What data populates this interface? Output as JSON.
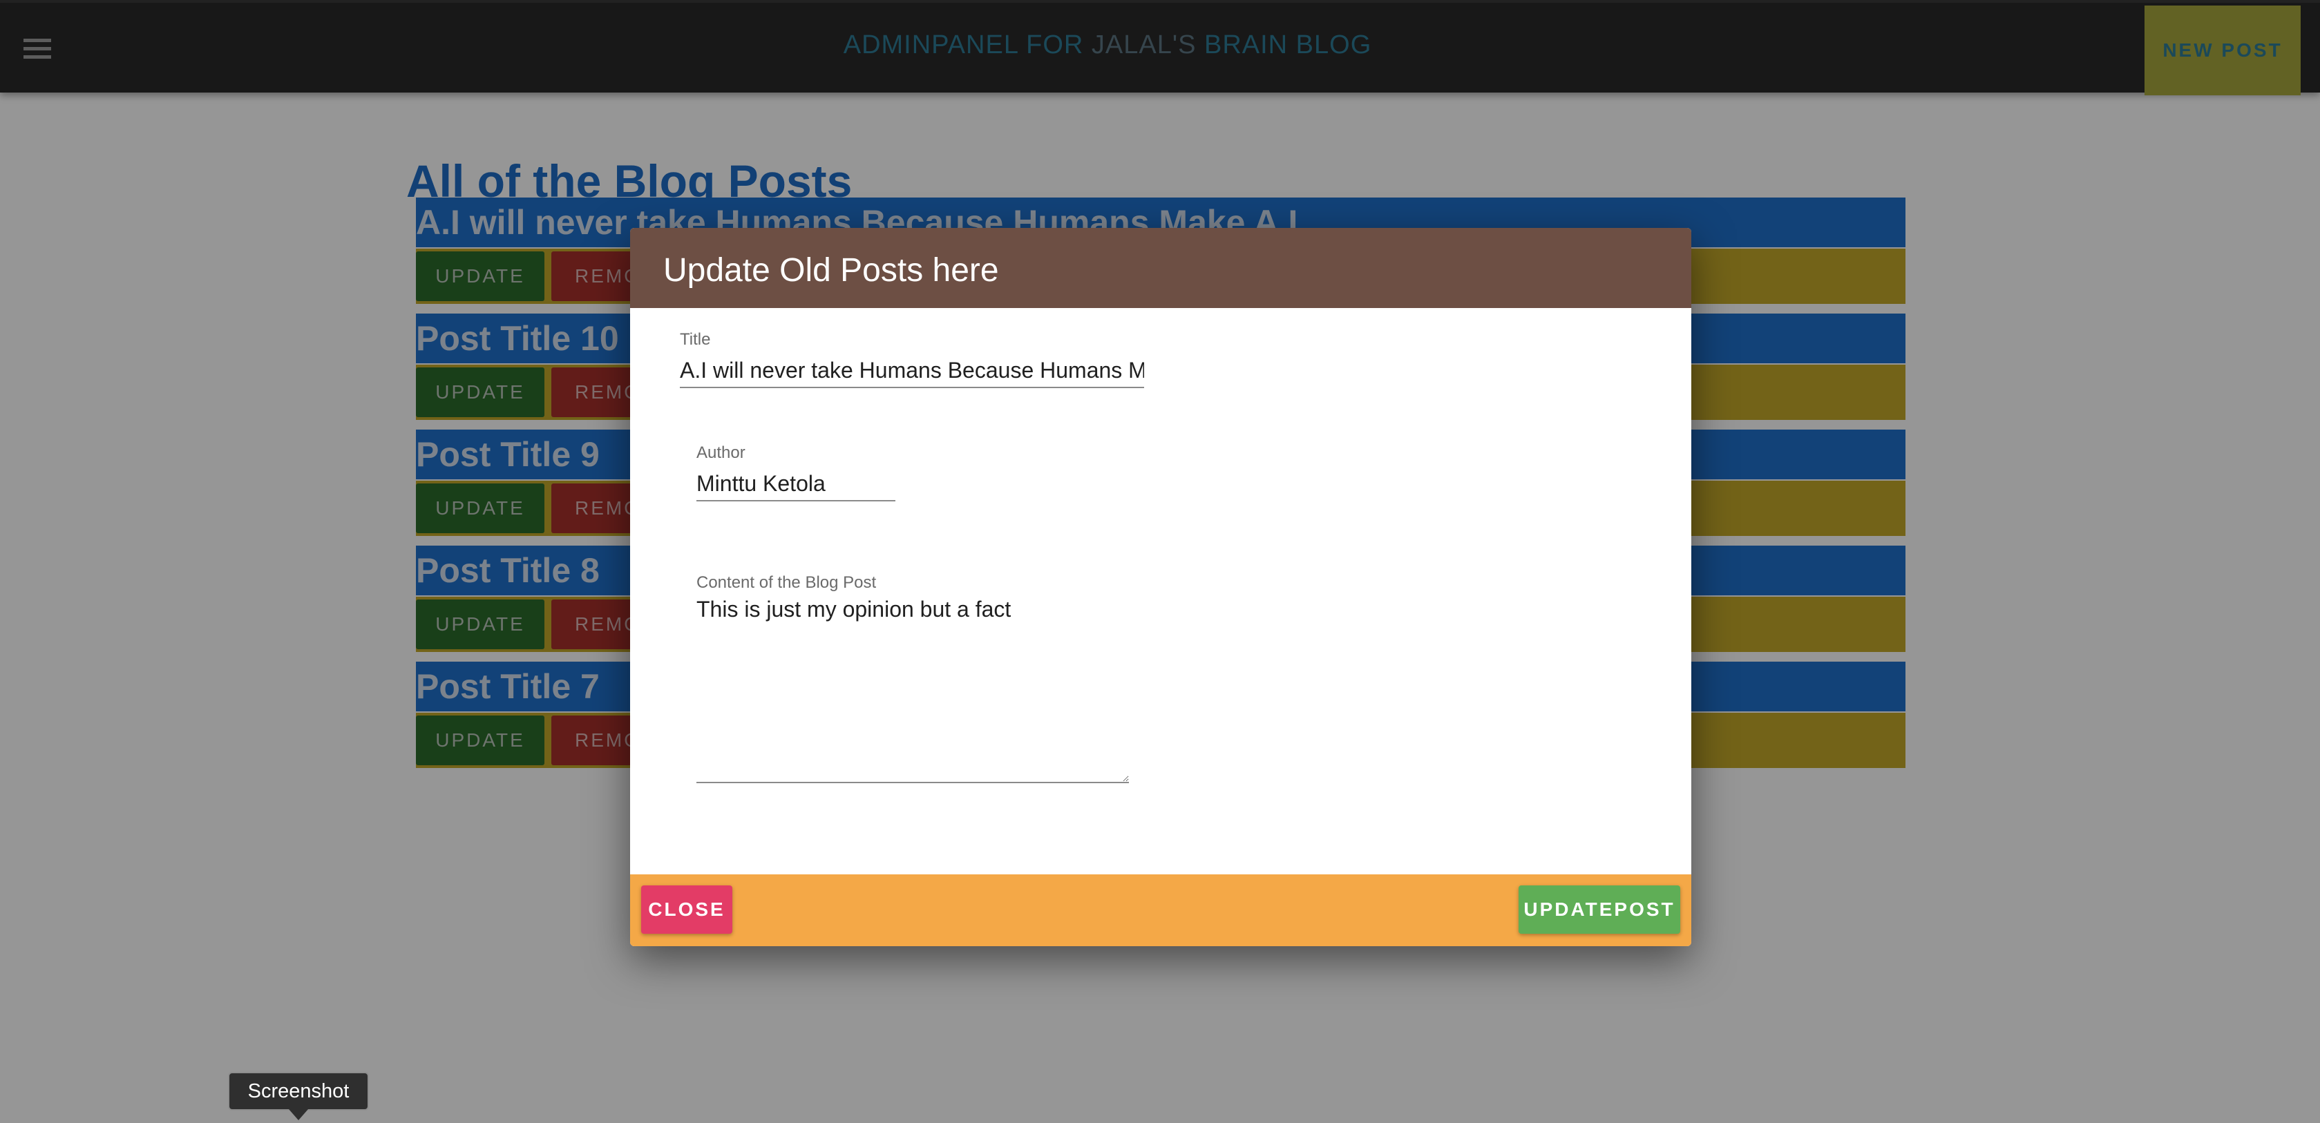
{
  "appbar": {
    "title_main": "ADMINPANEL FOR ",
    "title_muted": "JALAL'S",
    "title_rest": " BRAIN BLOG",
    "new_post_label": "NEW POST"
  },
  "page": {
    "heading": "All of the Blog Posts"
  },
  "posts": [
    {
      "title": "A.I will never take Humans Because Humans Make A.I",
      "update_label": "UPDATE",
      "remove_label": "REMO"
    },
    {
      "title": "Post Title 10",
      "update_label": "UPDATE",
      "remove_label": "REMO"
    },
    {
      "title": "Post Title 9",
      "update_label": "UPDATE",
      "remove_label": "REMO"
    },
    {
      "title": "Post Title 8",
      "update_label": "UPDATE",
      "remove_label": "REMO"
    },
    {
      "title": "Post Title 7",
      "update_label": "UPDATE",
      "remove_label": "REMO"
    }
  ],
  "dialog": {
    "header": "Update Old Posts here",
    "title_label": "Title",
    "title_value": "A.I will never take Humans Because Humans Make A.I",
    "author_label": "Author",
    "author_value": "Minttu Ketola",
    "content_label": "Content of the Blog Post",
    "content_value": "This is just my opinion but a fact",
    "close_label": "CLOSE",
    "update_label": "UPDATEPOST"
  },
  "tooltip": {
    "text": "Screenshot"
  },
  "colors": {
    "appbar_bg": "#282828",
    "title_color": "#2e7b94",
    "post_title_bg": "#1f6ec9",
    "post_actions_bg": "#c0a528",
    "dialog_header_bg": "#6d4f44",
    "dialog_footer_bg": "#f4a847",
    "close_bg": "#e33c66",
    "updatepost_bg": "#5fae56"
  },
  "icons": {
    "menu": "hamburger-menu-icon"
  }
}
